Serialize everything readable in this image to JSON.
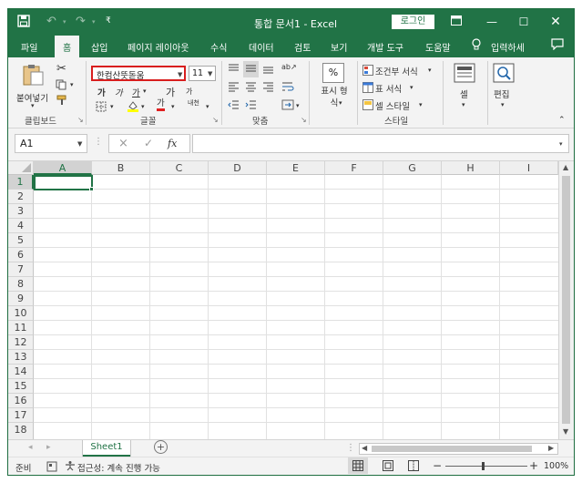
{
  "colors": {
    "brand": "#217346",
    "highlight_box": "#d81e1e"
  },
  "titlebar": {
    "title": "통합 문서1  -  Excel",
    "login_label": "로그인",
    "quick_access": [
      "save-icon",
      "undo-icon",
      "redo-icon",
      "customize-icon"
    ],
    "window_buttons": [
      "ribbon-display-icon",
      "minimize-icon",
      "maximize-icon",
      "close-icon"
    ]
  },
  "menu": {
    "tabs": [
      "파일",
      "홈",
      "삽입",
      "페이지 레이아웃",
      "수식",
      "데이터",
      "검토",
      "보기",
      "개발 도구",
      "도움말"
    ],
    "active_tab": "홈",
    "tell_me": "입력하세"
  },
  "ribbon": {
    "clipboard": {
      "paste_label": "붙여넣기",
      "group_label": "클립보드"
    },
    "font": {
      "font_name": "한컴산뜻돋움",
      "font_size": "11",
      "bold": "가",
      "italic": "가",
      "underline": "가",
      "grow": "가",
      "shrink": "가",
      "phonetic": "내천",
      "font_color": "가",
      "group_label": "글꼴"
    },
    "alignment": {
      "group_label": "맞춤"
    },
    "number": {
      "symbol": "%",
      "label": "표시 형식"
    },
    "styles": {
      "conditional": "조건부 서식",
      "table": "표 서식",
      "cell_style": "셀 스타일",
      "group_label": "스타일"
    },
    "cells": {
      "label": "셀"
    },
    "editing": {
      "label": "편집"
    }
  },
  "formula_bar": {
    "name_box": "A1",
    "cancel": "×",
    "enter": "✓",
    "fx": "fx",
    "formula": ""
  },
  "grid": {
    "columns": [
      "A",
      "B",
      "C",
      "D",
      "E",
      "F",
      "G",
      "H",
      "I"
    ],
    "rows": [
      "1",
      "2",
      "3",
      "4",
      "5",
      "6",
      "7",
      "8",
      "9",
      "10",
      "11",
      "12",
      "13",
      "14",
      "15",
      "16",
      "17",
      "18"
    ],
    "selected_cell": "A1"
  },
  "sheets": {
    "tabs": [
      "Sheet1"
    ],
    "add": "+"
  },
  "status": {
    "ready": "준비",
    "accessibility": "접근성: 계속 진행 가능",
    "zoom": "100%",
    "zoom_minus": "−",
    "zoom_plus": "+"
  }
}
